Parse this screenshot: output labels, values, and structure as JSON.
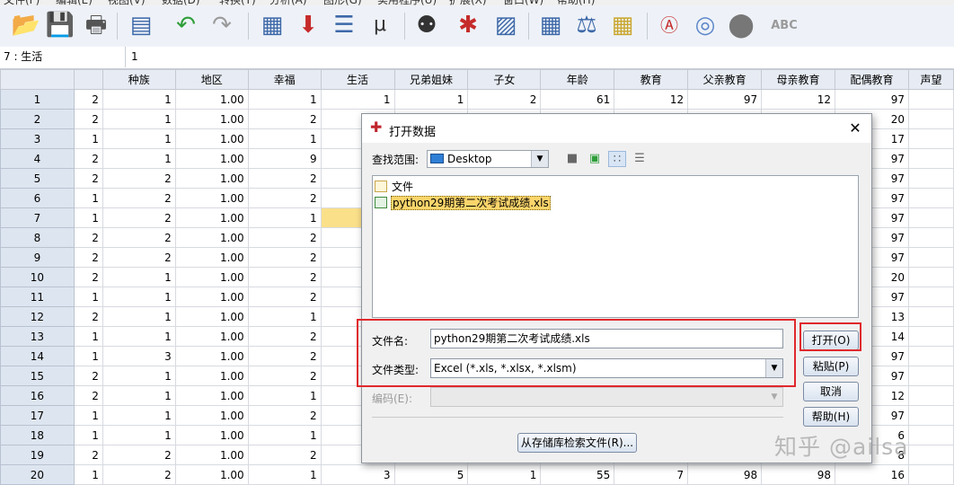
{
  "menubar": {
    "items": [
      "文件(F)",
      "编辑(E)",
      "视图(V)",
      "数据(D)",
      "转换(T)",
      "分析(A)",
      "图形(G)",
      "实用程序(U)",
      "扩展(X)",
      "窗口(W)",
      "帮助(H)"
    ]
  },
  "toolbar": {
    "icons": [
      "open-folder-icon",
      "save-icon",
      "print-icon",
      "dialog-recall-icon",
      "undo-icon",
      "redo-icon",
      "goto-case-icon",
      "goto-variable-icon",
      "variables-icon",
      "run-descriptives-icon",
      "find-icon",
      "insert-cases-icon",
      "insert-variable-icon",
      "split-file-icon",
      "weight-cases-icon",
      "select-cases-icon",
      "value-labels-icon",
      "use-variable-sets-icon",
      "show-all-variables-icon",
      "spell-check-icon"
    ]
  },
  "cellbar": {
    "ref": "7 : 生活",
    "value": "1"
  },
  "grid": {
    "columns": [
      "",
      "种族",
      "地区",
      "幸福",
      "生活",
      "兄弟姐妹",
      "子女",
      "年龄",
      "教育",
      "父亲教育",
      "母亲教育",
      "配偶教育",
      "声望"
    ],
    "rows": [
      {
        "n": "1",
        "cells": [
          "2",
          "1",
          "1.00",
          "1",
          "1",
          "1",
          "2",
          "61",
          "12",
          "97",
          "12",
          "97"
        ]
      },
      {
        "n": "2",
        "cells": [
          "2",
          "1",
          "1.00",
          "2",
          "",
          "",
          "",
          "",
          "",
          "",
          "",
          "20"
        ]
      },
      {
        "n": "3",
        "cells": [
          "1",
          "1",
          "1.00",
          "1",
          "",
          "",
          "",
          "",
          "",
          "",
          "",
          "17"
        ]
      },
      {
        "n": "4",
        "cells": [
          "2",
          "1",
          "1.00",
          "9",
          "",
          "",
          "",
          "",
          "",
          "",
          "",
          "97"
        ]
      },
      {
        "n": "5",
        "cells": [
          "2",
          "2",
          "1.00",
          "2",
          "",
          "",
          "",
          "",
          "",
          "",
          "",
          "97"
        ]
      },
      {
        "n": "6",
        "cells": [
          "1",
          "2",
          "1.00",
          "2",
          "",
          "",
          "",
          "",
          "",
          "",
          "",
          "97"
        ]
      },
      {
        "n": "7",
        "cells": [
          "1",
          "2",
          "1.00",
          "1",
          "",
          "",
          "",
          "",
          "",
          "",
          "",
          "97"
        ]
      },
      {
        "n": "8",
        "cells": [
          "2",
          "2",
          "1.00",
          "2",
          "",
          "",
          "",
          "",
          "",
          "",
          "",
          "97"
        ]
      },
      {
        "n": "9",
        "cells": [
          "2",
          "2",
          "1.00",
          "2",
          "",
          "",
          "",
          "",
          "",
          "",
          "",
          "97"
        ]
      },
      {
        "n": "10",
        "cells": [
          "2",
          "1",
          "1.00",
          "2",
          "",
          "",
          "",
          "",
          "",
          "",
          "",
          "20"
        ]
      },
      {
        "n": "11",
        "cells": [
          "1",
          "1",
          "1.00",
          "2",
          "",
          "",
          "",
          "",
          "",
          "",
          "",
          "97"
        ]
      },
      {
        "n": "12",
        "cells": [
          "2",
          "1",
          "1.00",
          "1",
          "",
          "",
          "",
          "",
          "",
          "",
          "",
          "13"
        ]
      },
      {
        "n": "13",
        "cells": [
          "1",
          "1",
          "1.00",
          "2",
          "",
          "",
          "",
          "",
          "",
          "",
          "",
          "14"
        ]
      },
      {
        "n": "14",
        "cells": [
          "1",
          "3",
          "1.00",
          "2",
          "",
          "",
          "",
          "",
          "",
          "",
          "",
          "97"
        ]
      },
      {
        "n": "15",
        "cells": [
          "2",
          "1",
          "1.00",
          "2",
          "",
          "",
          "",
          "",
          "",
          "",
          "",
          "97"
        ]
      },
      {
        "n": "16",
        "cells": [
          "2",
          "1",
          "1.00",
          "1",
          "",
          "",
          "",
          "",
          "",
          "",
          "",
          "12"
        ]
      },
      {
        "n": "17",
        "cells": [
          "1",
          "1",
          "1.00",
          "2",
          "",
          "",
          "",
          "",
          "",
          "",
          "",
          "97"
        ]
      },
      {
        "n": "18",
        "cells": [
          "1",
          "1",
          "1.00",
          "1",
          "",
          "",
          "",
          "",
          "",
          "",
          "",
          "6"
        ]
      },
      {
        "n": "19",
        "cells": [
          "2",
          "2",
          "1.00",
          "2",
          "",
          "",
          "",
          "",
          "",
          "",
          "",
          "8"
        ]
      },
      {
        "n": "20",
        "cells": [
          "1",
          "2",
          "1.00",
          "1",
          "3",
          "5",
          "1",
          "55",
          "7",
          "98",
          "98",
          "16"
        ]
      }
    ]
  },
  "dialog": {
    "title": "打开数据",
    "lookin_label": "查找范围:",
    "lookin_value": "Desktop",
    "files": [
      {
        "name": "文件",
        "type": "folder",
        "selected": false
      },
      {
        "name": "python29期第二次考试成绩.xls",
        "type": "excel",
        "selected": true
      }
    ],
    "filename_label": "文件名:",
    "filename_value": "python29期第二次考试成绩.xls",
    "filetype_label": "文件类型:",
    "filetype_value": "Excel (*.xls, *.xlsx, *.xlsm)",
    "encoding_label": "编码(E):",
    "encoding_value": "",
    "buttons": {
      "open": "打开(O)",
      "paste": "粘贴(P)",
      "cancel": "取消",
      "help": "帮助(H)"
    },
    "repo_button": "从存储库检索文件(R)...",
    "close_glyph": "✕"
  },
  "watermark": "知乎 @ailsa",
  "colors": {
    "highlight": "#e0282c",
    "selection": "#fbd56b",
    "row_header": "#dde5f0",
    "column_header": "#e7ecf4"
  }
}
